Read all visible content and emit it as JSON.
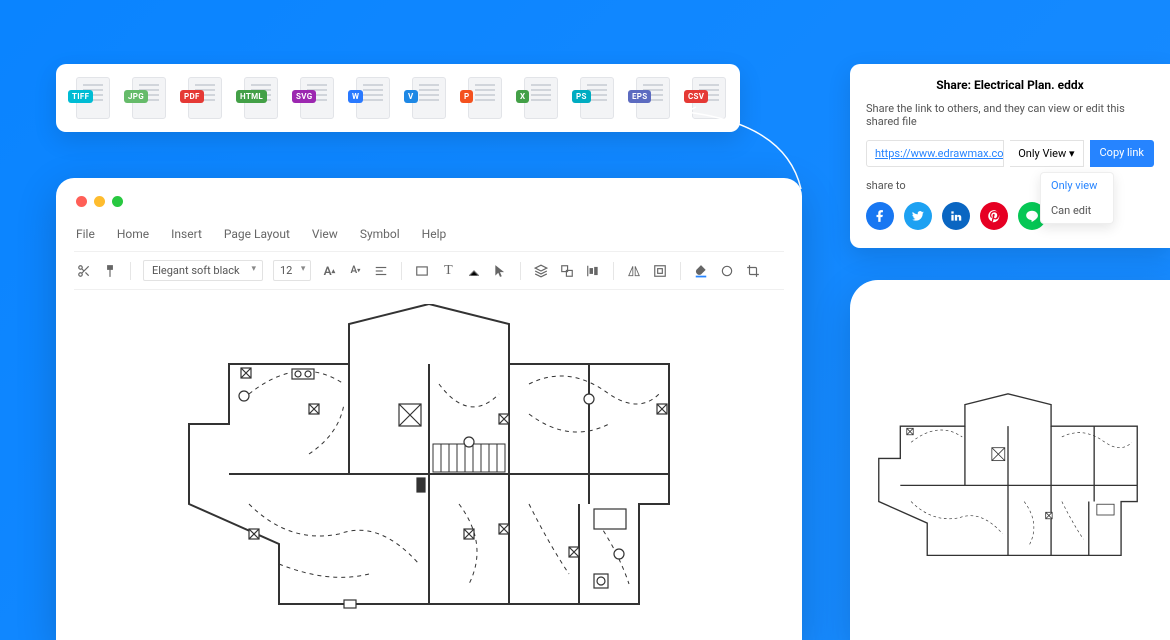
{
  "export_formats": [
    {
      "label": "TIFF",
      "color": "#00bcd4"
    },
    {
      "label": "JPG",
      "color": "#66bb6a"
    },
    {
      "label": "PDF",
      "color": "#e53935"
    },
    {
      "label": "HTML",
      "color": "#43a047"
    },
    {
      "label": "SVG",
      "color": "#9c27b0"
    },
    {
      "label": "W",
      "color": "#2979ff"
    },
    {
      "label": "V",
      "color": "#1e88e5"
    },
    {
      "label": "P",
      "color": "#f4511e"
    },
    {
      "label": "X",
      "color": "#43a047"
    },
    {
      "label": "PS",
      "color": "#00acc1"
    },
    {
      "label": "EPS",
      "color": "#5c6bc0"
    },
    {
      "label": "CSV",
      "color": "#e53935"
    }
  ],
  "app": {
    "menu": [
      "File",
      "Home",
      "Insert",
      "Page Layout",
      "View",
      "Symbol",
      "Help"
    ],
    "font_name": "Elegant soft black",
    "font_size": "12"
  },
  "share": {
    "title": "Share: Electrical Plan. eddx",
    "desc": "Share the link to others, and they can view or edit this shared file",
    "url": "https://www.edrawmax.com/online/files",
    "view_mode": "Only View ▾",
    "copy_label": "Copy link",
    "dropdown": [
      "Only view",
      "Can edit"
    ],
    "share_to_label": "share to",
    "social": [
      {
        "name": "facebook",
        "bg": "#1877f2",
        "glyph": "f"
      },
      {
        "name": "twitter",
        "bg": "#1da1f2",
        "glyph": "t"
      },
      {
        "name": "linkedin",
        "bg": "#0a66c2",
        "glyph": "in"
      },
      {
        "name": "pinterest",
        "bg": "#e60023",
        "glyph": "p"
      },
      {
        "name": "line",
        "bg": "#06c755",
        "glyph": "L"
      }
    ]
  }
}
